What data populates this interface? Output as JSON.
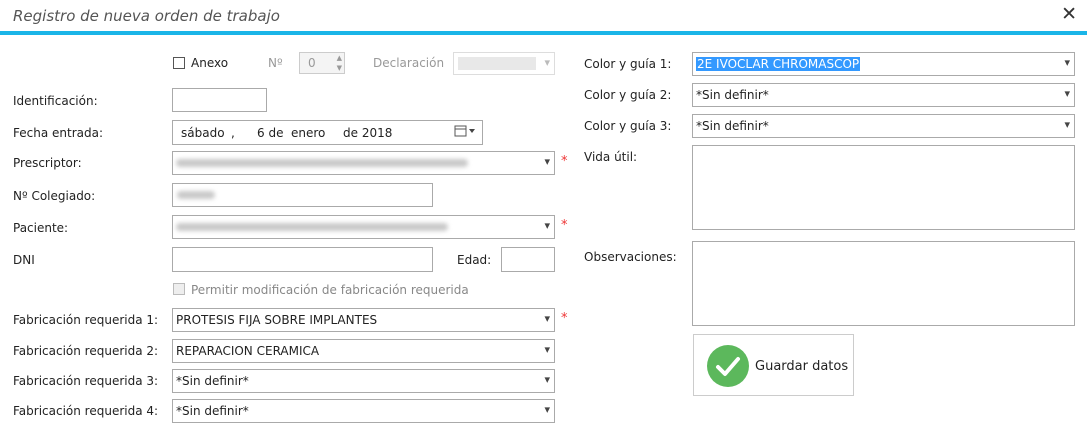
{
  "window": {
    "title": "Registro de nueva orden de trabajo",
    "close_label": "✕"
  },
  "annex": {
    "label": "Anexo",
    "no_label": "Nº",
    "no_value": "0",
    "declaration_label": "Declaración"
  },
  "fields": {
    "identificacion": {
      "label": "Identificación:",
      "value": ""
    },
    "fecha": {
      "label": "Fecha entrada:",
      "weekday": "sábado",
      "sep": ",",
      "day": "6 de",
      "month": "enero",
      "year": "de 2018"
    },
    "prescriptor": {
      "label": "Prescriptor:"
    },
    "colegiado": {
      "label": "Nº Colegiado:"
    },
    "paciente": {
      "label": "Paciente:"
    },
    "dni": {
      "label": "DNI",
      "value": ""
    },
    "edad": {
      "label": "Edad:",
      "value": ""
    },
    "permitir": {
      "label": "Permitir modificación de fabricación requerida"
    },
    "fab1": {
      "label": "Fabricación requerida 1:",
      "value": "PROTESIS FIJA SOBRE IMPLANTES"
    },
    "fab2": {
      "label": "Fabricación requerida 2:",
      "value": "REPARACION CERAMICA"
    },
    "fab3": {
      "label": "Fabricación requerida 3:",
      "value": "*Sin definir*"
    },
    "fab4": {
      "label": "Fabricación requerida 4:",
      "value": "*Sin definir*"
    },
    "color1": {
      "label": "Color y guía 1:",
      "value": "2E IVOCLAR CHROMASCOP"
    },
    "color2": {
      "label": "Color y guía 2:",
      "value": "*Sin definir*"
    },
    "color3": {
      "label": "Color y guía 3:",
      "value": "*Sin definir*"
    },
    "vida": {
      "label": "Vida útil:"
    },
    "obs": {
      "label": "Observaciones:"
    }
  },
  "required_mark": "*",
  "save_button": {
    "label": "Guardar datos"
  },
  "icons": {
    "dropdown": "chevron-down-icon",
    "calendar": "calendar-icon",
    "check": "check-icon"
  },
  "colors": {
    "accent": "#1ab5e8",
    "required": "#e33333",
    "save_icon": "#5cb85c",
    "selection": "#3399ff"
  }
}
